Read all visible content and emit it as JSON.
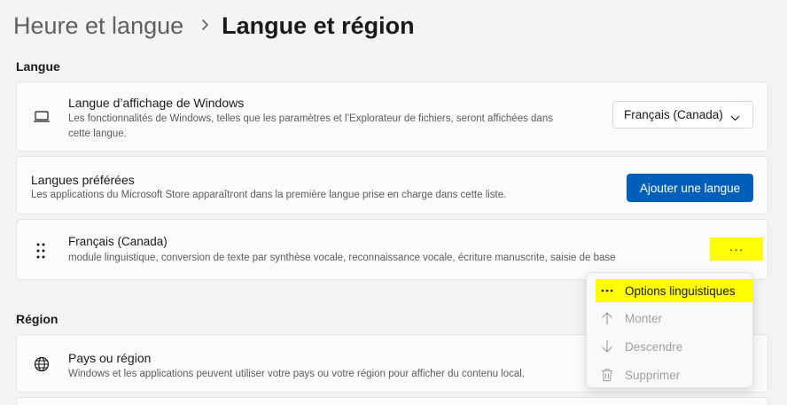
{
  "breadcrumb": {
    "parent": "Heure et langue",
    "current": "Langue et région"
  },
  "sections": {
    "language_label": "Langue",
    "region_label": "Région"
  },
  "display_language": {
    "icon": "laptop-icon",
    "title": "Langue d’affichage de Windows",
    "description_line1": "Les fonctionnalités de Windows, telles que les paramètres et l’Explorateur de fichiers, seront affichées dans",
    "description_line2": "cette langue.",
    "selected": "Français (Canada)"
  },
  "preferred_languages": {
    "title": "Langues préférées",
    "description": "Les applications du Microsoft Store apparaîtront dans la première langue prise en charge dans cette liste.",
    "add_button": "Ajouter une langue"
  },
  "language_item": {
    "icon": "drag-handle-icon",
    "name": "Français (Canada)",
    "features": "module linguistique, conversion de texte par synthèse vocale, reconnaissance vocale, écriture manuscrite, saisie de base",
    "more_button": "···"
  },
  "context_menu": {
    "items": [
      {
        "label": "Options linguistiques",
        "icon": "more-icon",
        "state": "highlighted"
      },
      {
        "label": "Monter",
        "icon": "arrow-up-icon",
        "state": "disabled"
      },
      {
        "label": "Descendre",
        "icon": "arrow-down-icon",
        "state": "disabled"
      },
      {
        "label": "Supprimer",
        "icon": "trash-icon",
        "state": "disabled"
      }
    ]
  },
  "region": {
    "icon": "globe-icon",
    "title": "Pays ou région",
    "description": "Windows et les applications peuvent utiliser votre pays ou votre région pour afficher du contenu local."
  },
  "colors": {
    "accent": "#005fb8",
    "highlight": "#ffff00",
    "background": "#f3f3f3",
    "card": "#fbfbfb"
  }
}
